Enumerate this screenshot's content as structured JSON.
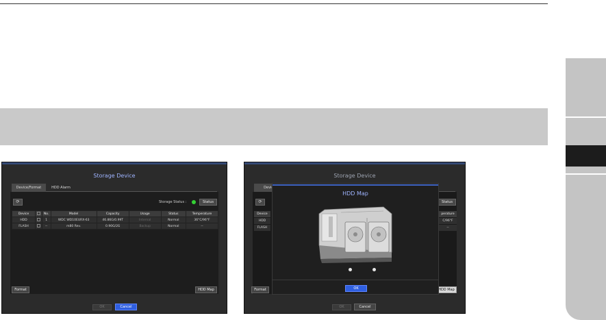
{
  "left": {
    "title": "Storage Device",
    "tabs": [
      "Device/Format",
      "HDD Alarm"
    ],
    "refresh_icon": "refresh-icon",
    "storage_status_label": "Storage Status :",
    "status_button": "Status",
    "columns": [
      "Device",
      "No.",
      "Model",
      "Capacity",
      "Usage",
      "Status",
      "Temperature"
    ],
    "rows": [
      {
        "device": "HDD",
        "no": "1",
        "model": "WDC WD10EURX-63",
        "capacity": "46.86G/0.99T",
        "usage": "Internal",
        "status": "Normal",
        "temperature": "36°C/96°F"
      },
      {
        "device": "FLASH",
        "no": "--",
        "model": "m80 Rev.",
        "capacity": "0.90G/2G",
        "usage": "Backup",
        "status": "Normal",
        "temperature": "--"
      }
    ],
    "format_button": "Format",
    "hdd_map_button": "HDD Map",
    "ok_button": "OK",
    "cancel_button": "Cancel"
  },
  "right": {
    "title": "Storage Device",
    "tab_visible": "Device/F",
    "status_button": "Status",
    "device_col": "Device",
    "temperature_col_partial": "perature",
    "row1_device": "HDD",
    "row1_temperature_partial": "C/96°F",
    "row2_device": "FLASH",
    "row2_temperature": "--",
    "format_button": "Format",
    "hdd_map_button_partial": "HDD Map",
    "ok_button": "OK",
    "cancel_button": "Cancel",
    "modal": {
      "title": "HDD Map",
      "ok_button": "OK"
    }
  }
}
